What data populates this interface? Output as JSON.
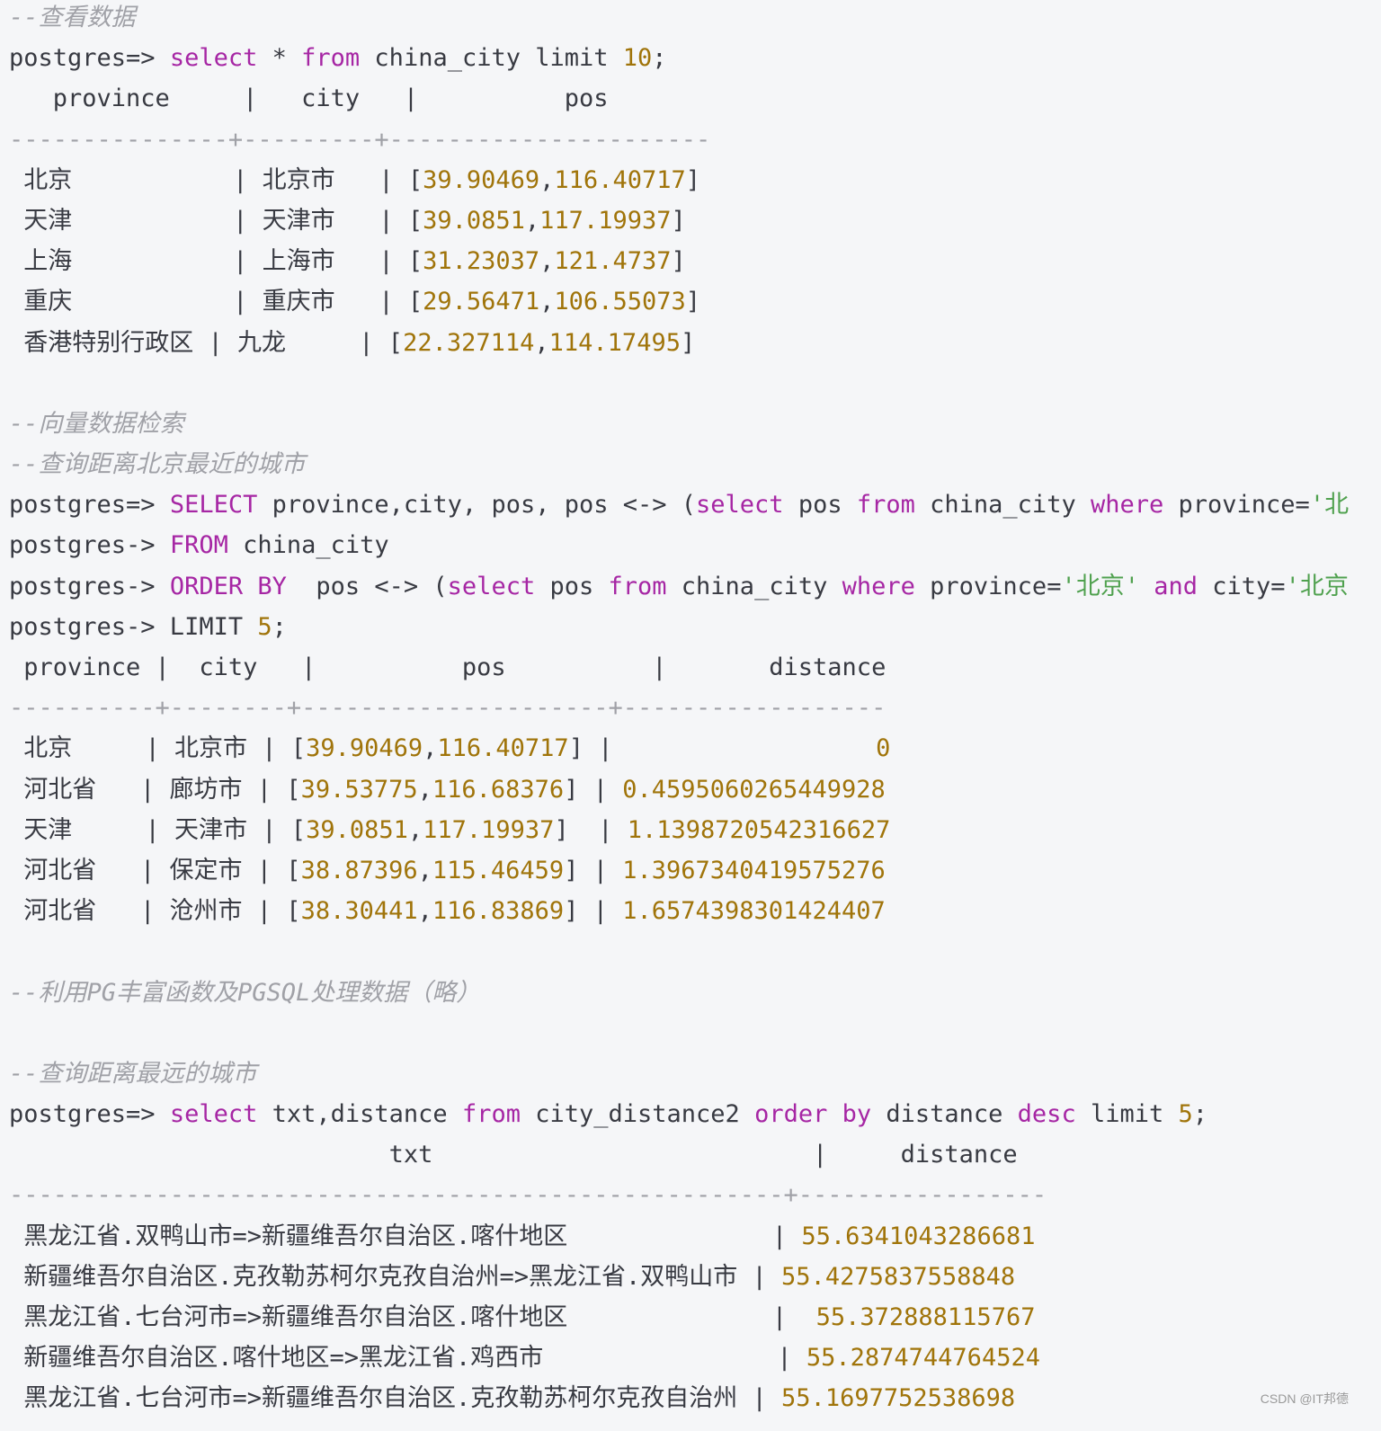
{
  "colors": {
    "background": "#f5f6f8",
    "keyword": "#a626a4",
    "number": "#a0740a",
    "string": "#50a14f",
    "comment": "#a0a1a7",
    "text": "#383a42"
  },
  "lines": [
    [
      [
        "--查看数据",
        "cm"
      ]
    ],
    [
      [
        "postgres=> ",
        ""
      ],
      [
        "select",
        "kw"
      ],
      [
        " * ",
        ""
      ],
      [
        "from",
        "kw"
      ],
      [
        " china_city limit ",
        ""
      ],
      [
        "10",
        "num"
      ],
      [
        ";",
        ""
      ]
    ],
    [
      [
        "   province     |   city   |          pos",
        ""
      ]
    ],
    [
      [
        "---------------+---------+----------------------",
        "sep"
      ]
    ],
    [
      [
        " 北京           | 北京市   | [",
        ""
      ],
      [
        "39.90469",
        "num"
      ],
      [
        ",",
        ""
      ],
      [
        "116.40717",
        "num"
      ],
      [
        "]",
        ""
      ]
    ],
    [
      [
        " 天津           | 天津市   | [",
        ""
      ],
      [
        "39.0851",
        "num"
      ],
      [
        ",",
        ""
      ],
      [
        "117.19937",
        "num"
      ],
      [
        "]",
        ""
      ]
    ],
    [
      [
        " 上海           | 上海市   | [",
        ""
      ],
      [
        "31.23037",
        "num"
      ],
      [
        ",",
        ""
      ],
      [
        "121.4737",
        "num"
      ],
      [
        "]",
        ""
      ]
    ],
    [
      [
        " 重庆           | 重庆市   | [",
        ""
      ],
      [
        "29.56471",
        "num"
      ],
      [
        ",",
        ""
      ],
      [
        "106.55073",
        "num"
      ],
      [
        "]",
        ""
      ]
    ],
    [
      [
        " 香港特别行政区 | 九龙     | [",
        ""
      ],
      [
        "22.327114",
        "num"
      ],
      [
        ",",
        ""
      ],
      [
        "114.17495",
        "num"
      ],
      [
        "]",
        ""
      ]
    ],
    [],
    [
      [
        "--向量数据检索",
        "cm"
      ]
    ],
    [
      [
        "--查询距离北京最近的城市",
        "cm"
      ]
    ],
    [
      [
        "postgres=> ",
        ""
      ],
      [
        "SELECT",
        "kw"
      ],
      [
        " province,city, pos, pos <-> (",
        ""
      ],
      [
        "select",
        "kw"
      ],
      [
        " pos ",
        ""
      ],
      [
        "from",
        "kw"
      ],
      [
        " china_city ",
        ""
      ],
      [
        "where",
        "kw"
      ],
      [
        " province=",
        ""
      ],
      [
        "'北",
        "str"
      ]
    ],
    [
      [
        "postgres-> ",
        ""
      ],
      [
        "FROM",
        "kw"
      ],
      [
        " china_city",
        ""
      ]
    ],
    [
      [
        "postgres-> ",
        ""
      ],
      [
        "ORDER BY",
        "kw"
      ],
      [
        "  pos <-> (",
        ""
      ],
      [
        "select",
        "kw"
      ],
      [
        " pos ",
        ""
      ],
      [
        "from",
        "kw"
      ],
      [
        " china_city ",
        ""
      ],
      [
        "where",
        "kw"
      ],
      [
        " province=",
        ""
      ],
      [
        "'北京'",
        "str"
      ],
      [
        " ",
        ""
      ],
      [
        "and",
        "kw"
      ],
      [
        " city=",
        ""
      ],
      [
        "'北京",
        "str"
      ]
    ],
    [
      [
        "postgres-> LIMIT ",
        ""
      ],
      [
        "5",
        "num"
      ],
      [
        ";",
        ""
      ]
    ],
    [
      [
        " province |  city   |          pos          |       distance",
        ""
      ]
    ],
    [
      [
        "----------+--------+---------------------+------------------",
        "sep"
      ]
    ],
    [
      [
        " 北京     | 北京市 | [",
        ""
      ],
      [
        "39.90469",
        "num"
      ],
      [
        ",",
        ""
      ],
      [
        "116.40717",
        "num"
      ],
      [
        "] |                  ",
        ""
      ],
      [
        "0",
        "num"
      ]
    ],
    [
      [
        " 河北省   | 廊坊市 | [",
        ""
      ],
      [
        "39.53775",
        "num"
      ],
      [
        ",",
        ""
      ],
      [
        "116.68376",
        "num"
      ],
      [
        "] | ",
        ""
      ],
      [
        "0.4595060265449928",
        "num"
      ]
    ],
    [
      [
        " 天津     | 天津市 | [",
        ""
      ],
      [
        "39.0851",
        "num"
      ],
      [
        ",",
        ""
      ],
      [
        "117.19937",
        "num"
      ],
      [
        "]  | ",
        ""
      ],
      [
        "1.1398720542316627",
        "num"
      ]
    ],
    [
      [
        " 河北省   | 保定市 | [",
        ""
      ],
      [
        "38.87396",
        "num"
      ],
      [
        ",",
        ""
      ],
      [
        "115.46459",
        "num"
      ],
      [
        "] | ",
        ""
      ],
      [
        "1.3967340419575276",
        "num"
      ]
    ],
    [
      [
        " 河北省   | 沧州市 | [",
        ""
      ],
      [
        "38.30441",
        "num"
      ],
      [
        ",",
        ""
      ],
      [
        "116.83869",
        "num"
      ],
      [
        "] | ",
        ""
      ],
      [
        "1.6574398301424407",
        "num"
      ]
    ],
    [],
    [
      [
        "--利用PG丰富函数及PGSQL处理数据（略）",
        "cm"
      ]
    ],
    [],
    [
      [
        "--查询距离最远的城市",
        "cm"
      ]
    ],
    [
      [
        "postgres=> ",
        ""
      ],
      [
        "select",
        "kw"
      ],
      [
        " txt,distance ",
        ""
      ],
      [
        "from",
        "kw"
      ],
      [
        " city_distance2 ",
        ""
      ],
      [
        "order by",
        "kw"
      ],
      [
        " distance ",
        ""
      ],
      [
        "desc",
        "kw"
      ],
      [
        " limit ",
        ""
      ],
      [
        "5",
        "num"
      ],
      [
        ";",
        ""
      ]
    ],
    [
      [
        "                          txt                          |     distance",
        ""
      ]
    ],
    [
      [
        "-----------------------------------------------------+-----------------",
        "sep"
      ]
    ],
    [
      [
        " 黑龙江省.双鸭山市=>新疆维吾尔自治区.喀什地区              | ",
        ""
      ],
      [
        "55.6341043286681",
        "num"
      ]
    ],
    [
      [
        " 新疆维吾尔自治区.克孜勒苏柯尔克孜自治州=>黑龙江省.双鸭山市 | ",
        ""
      ],
      [
        "55.4275837558848",
        "num"
      ]
    ],
    [
      [
        " 黑龙江省.七台河市=>新疆维吾尔自治区.喀什地区              |  ",
        ""
      ],
      [
        "55.372888115767",
        "num"
      ]
    ],
    [
      [
        " 新疆维吾尔自治区.喀什地区=>黑龙江省.鸡西市                | ",
        ""
      ],
      [
        "55.2874744764524",
        "num"
      ]
    ],
    [
      [
        " 黑龙江省.七台河市=>新疆维吾尔自治区.克孜勒苏柯尔克孜自治州 | ",
        ""
      ],
      [
        "55.1697752538698",
        "num"
      ]
    ]
  ],
  "watermark": "CSDN @IT邦德"
}
